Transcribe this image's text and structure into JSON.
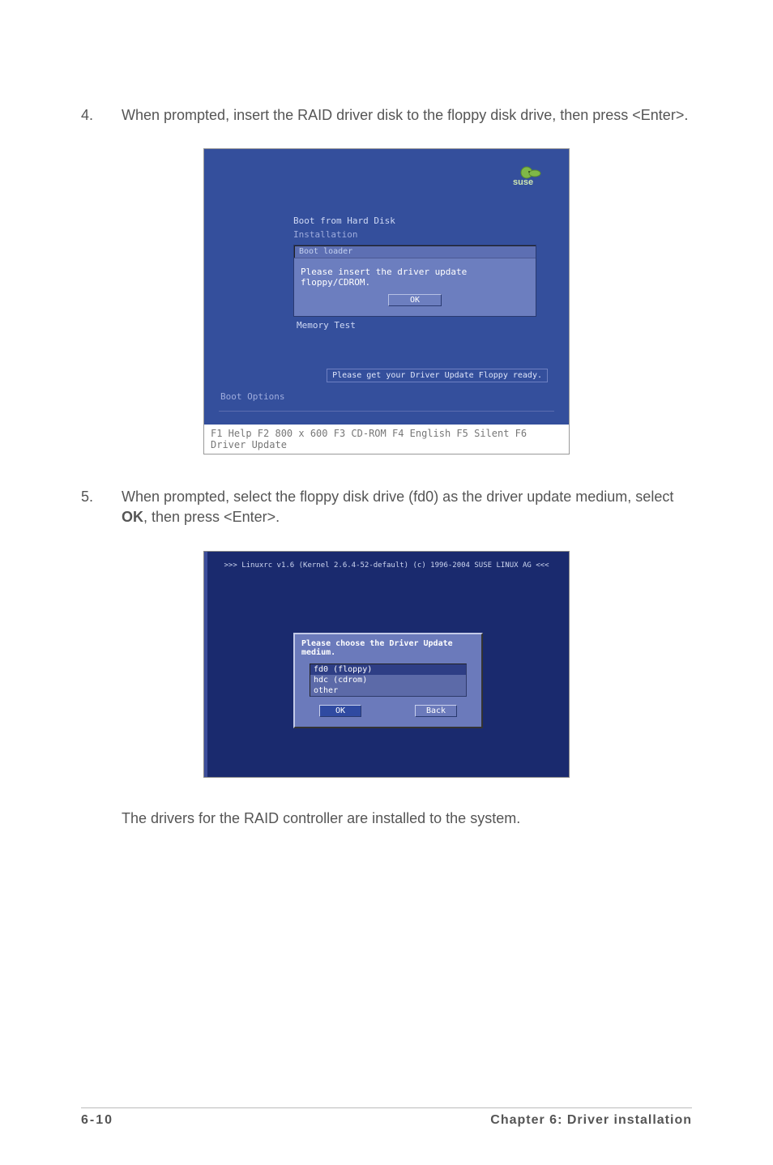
{
  "step4": {
    "num": "4.",
    "text": "When prompted, insert the RAID driver disk to the floppy disk drive, then press <Enter>."
  },
  "step5": {
    "num": "5.",
    "text_before": "When prompted, select the floppy disk drive (fd0) as the driver update medium, select ",
    "ok_word": "OK",
    "text_after": ", then press <Enter>."
  },
  "closing": "The drivers for the RAID controller are installed to the system.",
  "footer": {
    "page": "6-10",
    "chapter": "Chapter 6: Driver installation"
  },
  "ss1": {
    "logo": "suse",
    "menu_top": "Boot from Hard Disk",
    "menu_install": "Installation",
    "dialog_title": "Boot loader",
    "dialog_text": "Please insert the driver update floppy/CDROM.",
    "ok": "OK",
    "memtest": "Memory Test",
    "get_ready": "Please get your Driver Update Floppy ready.",
    "boot_options": "Boot Options",
    "fkeys": "F1 Help  F2 800 x 600  F3 CD-ROM  F4 English  F5 Silent  F6 Driver Update"
  },
  "ss2": {
    "header": ">>> Linuxrc v1.6 (Kernel 2.6.4-52-default) (c) 1996-2004 SUSE LINUX AG <<<",
    "dialog_title": "Please choose the Driver Update medium.",
    "opt_fd0": "fd0 (floppy)",
    "opt_hdc": "hdc (cdrom)",
    "opt_other": "other",
    "ok": "OK",
    "back": "Back"
  }
}
